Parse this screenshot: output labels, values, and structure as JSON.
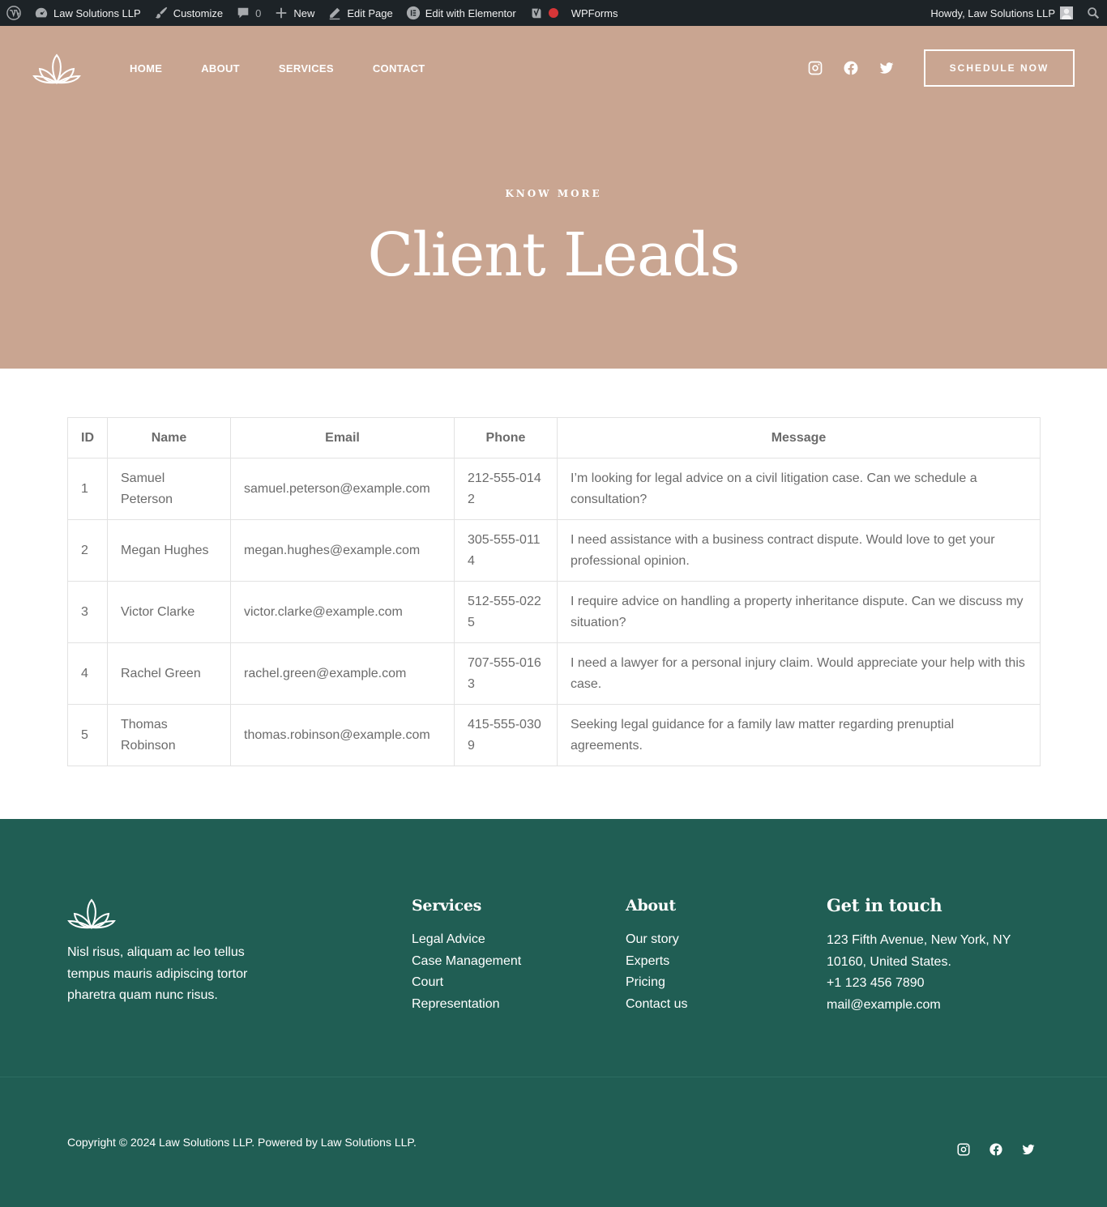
{
  "colors": {
    "admin_bar_bg": "#1d2327",
    "hero_bg": "#c9a591",
    "footer_bg": "#205e54",
    "footer_divider": "#2c6c61",
    "admin_red_dot": "#d63638"
  },
  "admin_bar": {
    "site_name": "Law Solutions LLP",
    "customize": "Customize",
    "comments_count": "0",
    "new": "New",
    "edit_page": "Edit Page",
    "edit_elementor": "Edit with Elementor",
    "wpforms": "WPForms",
    "howdy": "Howdy, Law Solutions LLP"
  },
  "header": {
    "nav": [
      "HOME",
      "ABOUT",
      "SERVICES",
      "CONTACT"
    ],
    "schedule_button": "SCHEDULE NOW",
    "socials": [
      "instagram-icon",
      "facebook-icon",
      "twitter-icon"
    ]
  },
  "hero": {
    "kicker": "KNOW MORE",
    "title": "Client Leads"
  },
  "table": {
    "headers": [
      "ID",
      "Name",
      "Email",
      "Phone",
      "Message"
    ],
    "rows": [
      {
        "id": "1",
        "name": "Samuel Peterson",
        "email": "samuel.peterson@example.com",
        "phone": "212-555-0142",
        "message": "I’m looking for legal advice on a civil litigation case. Can we schedule a consultation?"
      },
      {
        "id": "2",
        "name": "Megan Hughes",
        "email": "megan.hughes@example.com",
        "phone": "305-555-0114",
        "message": "I need assistance with a business contract dispute. Would love to get your professional opinion."
      },
      {
        "id": "3",
        "name": "Victor Clarke",
        "email": "victor.clarke@example.com",
        "phone": "512-555-0225",
        "message": "I require advice on handling a property inheritance dispute. Can we discuss my situation?"
      },
      {
        "id": "4",
        "name": "Rachel Green",
        "email": "rachel.green@example.com",
        "phone": "707-555-0163",
        "message": "I need a lawyer for a personal injury claim. Would appreciate your help with this case."
      },
      {
        "id": "5",
        "name": "Thomas Robinson",
        "email": "thomas.robinson@example.com",
        "phone": "415-555-0309",
        "message": "Seeking legal guidance for a family law matter regarding prenuptial agreements."
      }
    ]
  },
  "footer": {
    "about_text": "Nisl risus, aliquam ac leo tellus tempus mauris adipiscing tortor pharetra quam nunc risus.",
    "services_title": "Services",
    "services": [
      "Legal Advice",
      "Case Management",
      "Court",
      "Representation"
    ],
    "about_title": "About",
    "about_links": [
      "Our story",
      "Experts",
      "Pricing",
      "Contact us"
    ],
    "contact_title": "Get in touch",
    "address": "123 Fifth Avenue, New York, NY 10160, United States.",
    "phone": "+1 123 456 7890",
    "email": "mail@example.com",
    "copyright": "Copyright © 2024 Law Solutions LLP. Powered by Law Solutions LLP."
  }
}
